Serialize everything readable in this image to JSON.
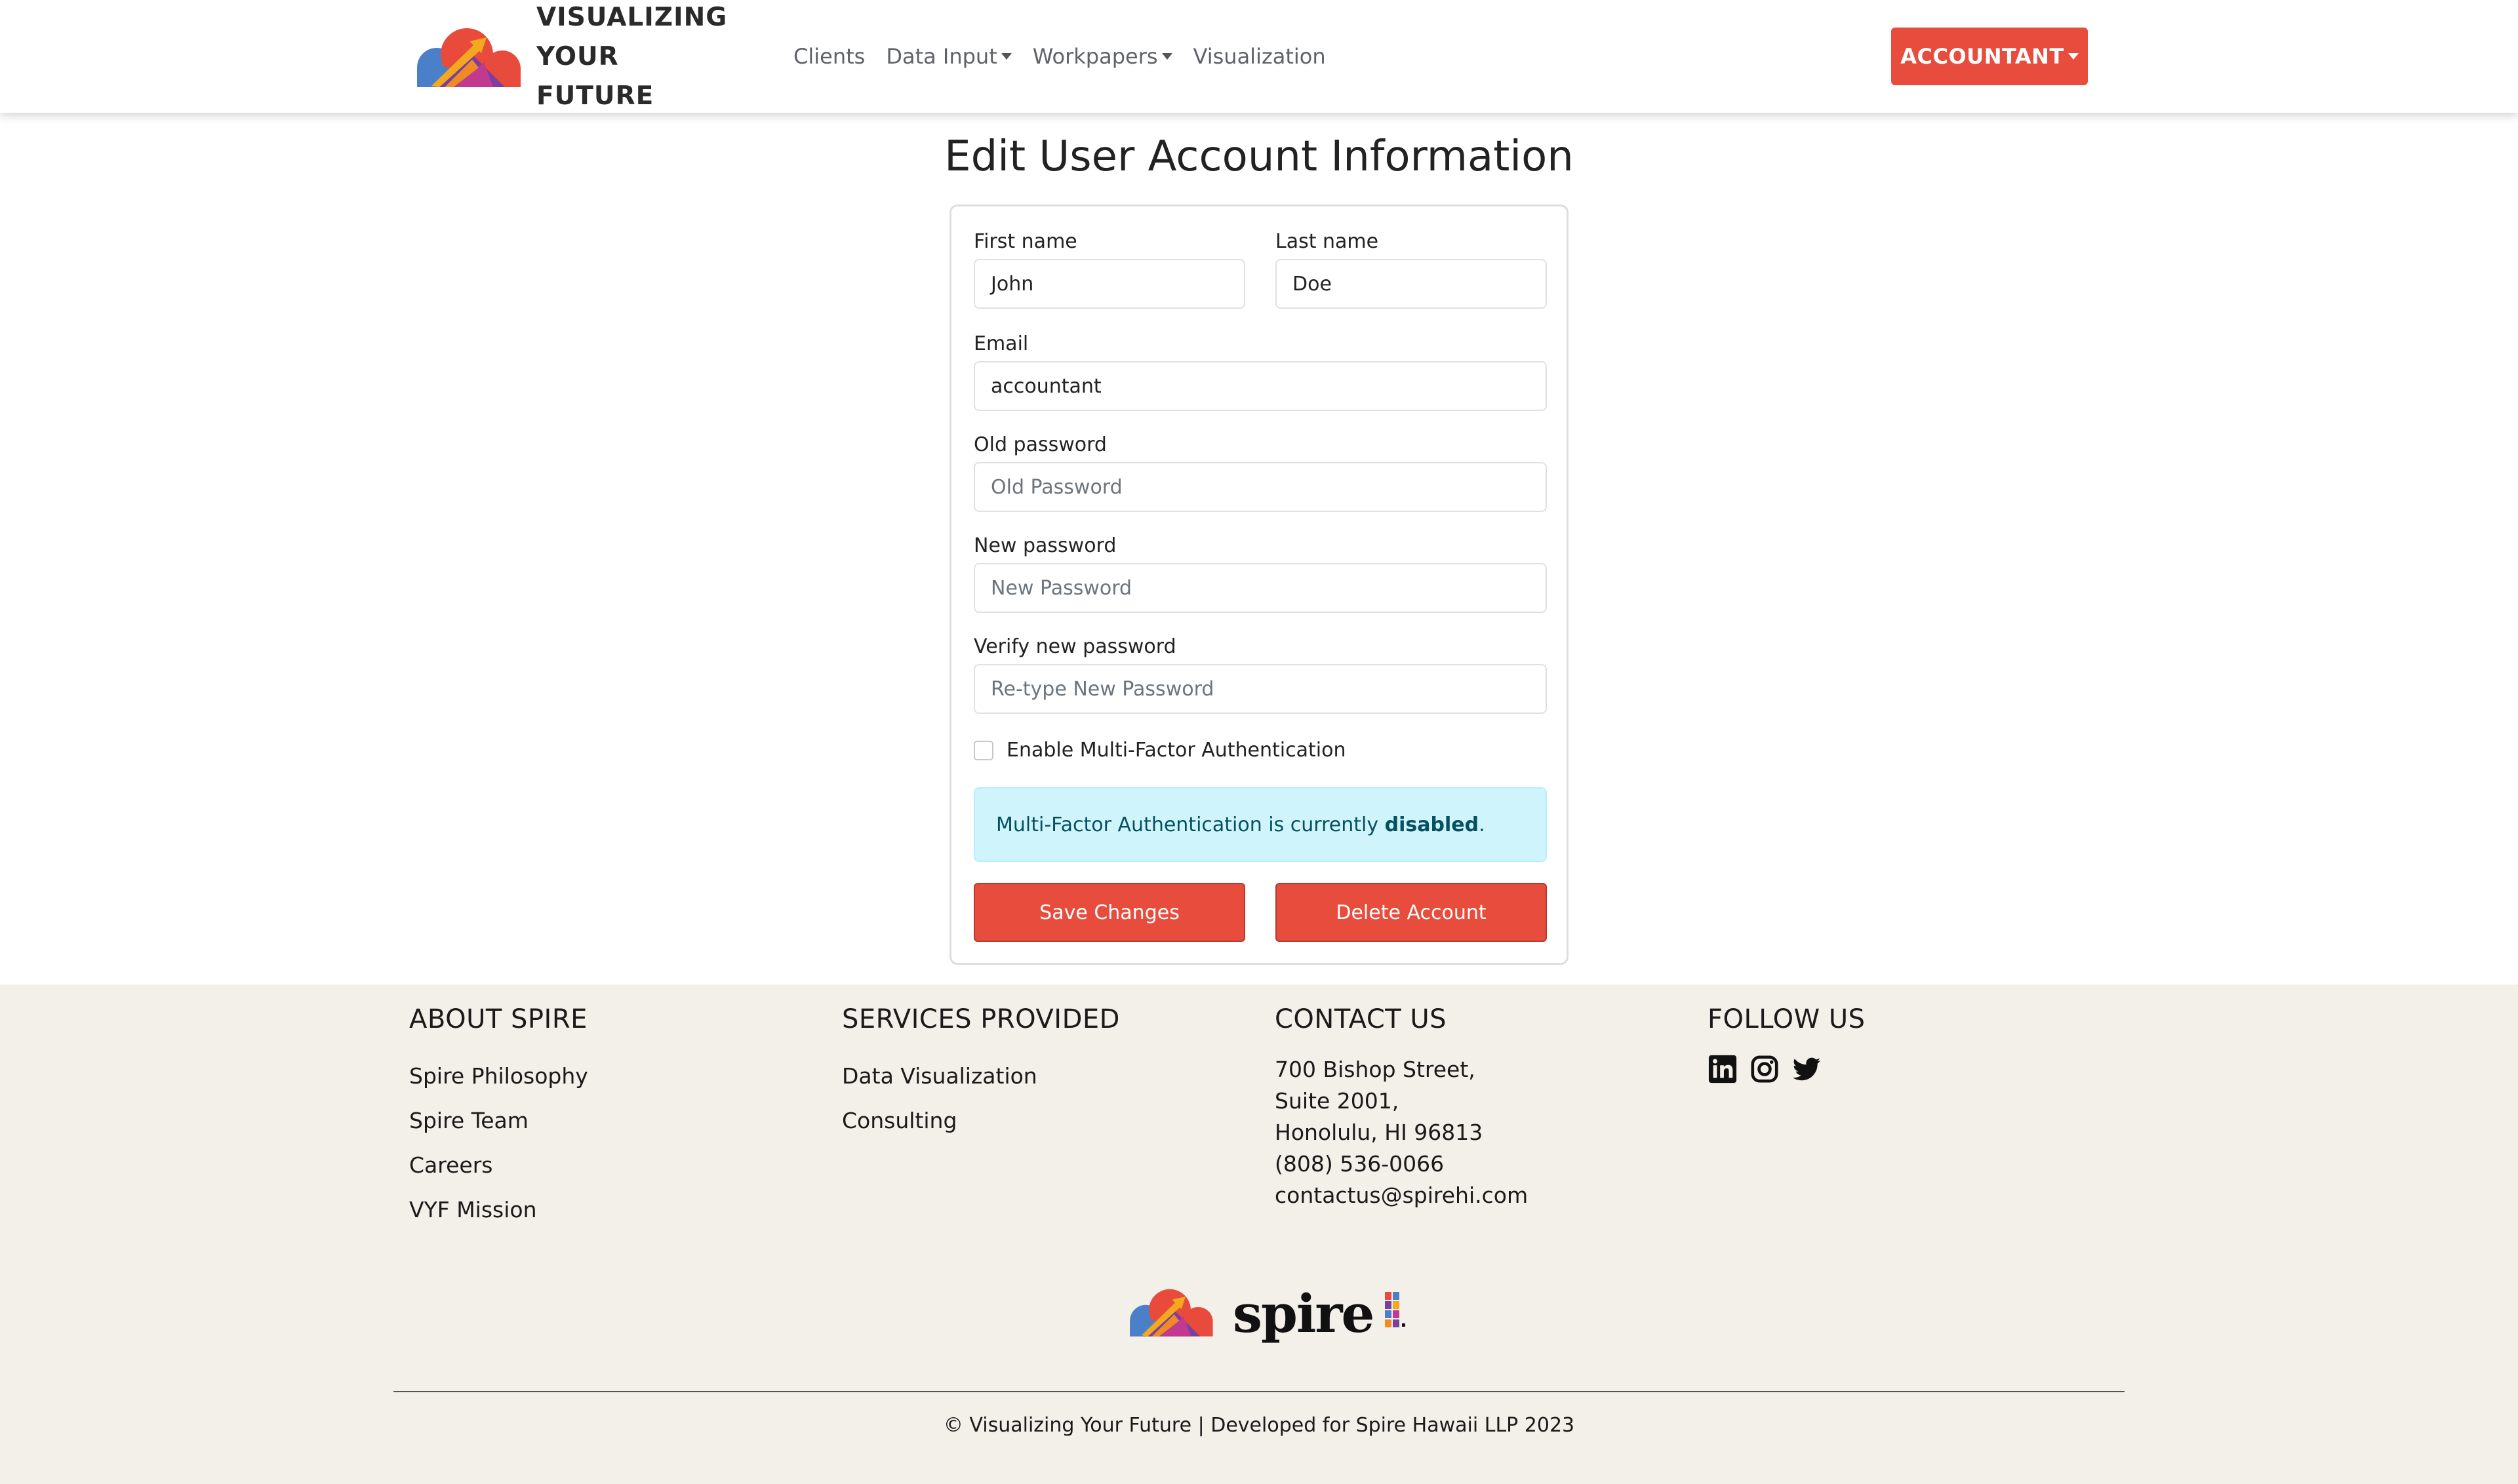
{
  "navbar": {
    "brand_line1": "VISUALIZING",
    "brand_line2": "YOUR FUTURE",
    "links": [
      "Clients",
      "Data Input",
      "Workpapers",
      "Visualization"
    ],
    "account_label": "ACCOUNTANT"
  },
  "page": {
    "title": "Edit User Account Information"
  },
  "form": {
    "first_name_label": "First name",
    "first_name_value": "John",
    "last_name_label": "Last name",
    "last_name_value": "Doe",
    "email_label": "Email",
    "email_value": "accountant",
    "old_password_label": "Old password",
    "old_password_placeholder": "Old Password",
    "new_password_label": "New password",
    "new_password_placeholder": "New Password",
    "verify_password_label": "Verify new password",
    "verify_password_placeholder": "Re-type New Password",
    "mfa_checkbox_label": "Enable Multi-Factor Authentication",
    "mfa_alert_prefix": "Multi-Factor Authentication is currently ",
    "mfa_alert_status": "disabled",
    "mfa_alert_suffix": ".",
    "save_label": "Save Changes",
    "delete_label": "Delete Account"
  },
  "footer": {
    "about_heading": "ABOUT SPIRE",
    "about_links": [
      "Spire Philosophy",
      "Spire Team",
      "Careers",
      "VYF Mission"
    ],
    "services_heading": "SERVICES PROVIDED",
    "services_links": [
      "Data Visualization",
      "Consulting"
    ],
    "contact_heading": "CONTACT US",
    "contact_lines": [
      "700 Bishop Street,",
      "Suite 2001,",
      "Honolulu, HI 96813",
      "(808) 536-0066",
      "contactus@spirehi.com"
    ],
    "follow_heading": "FOLLOW US",
    "social_icons": [
      "linkedin-icon",
      "instagram-icon",
      "twitter-icon"
    ],
    "logo_word": "spire",
    "copyright": "© Visualizing Your Future | Developed for Spire Hawaii LLP 2023"
  },
  "colors": {
    "accent": "#e74c3c",
    "footer_bg": "#f3efe9",
    "alert_bg": "#cff4fc",
    "alert_text": "#055160"
  }
}
